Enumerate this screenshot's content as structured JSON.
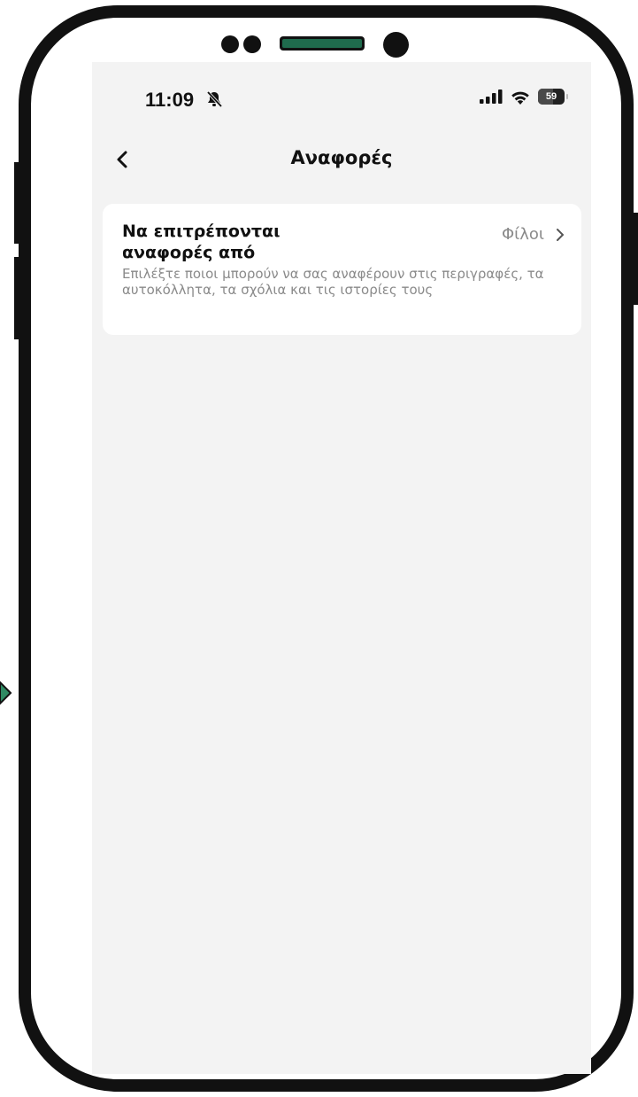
{
  "status_bar": {
    "time": "11:09",
    "battery": "59",
    "icons": [
      "bell-slash-icon",
      "signal-icon",
      "wifi-icon",
      "battery-icon"
    ]
  },
  "header": {
    "title": "Αναφορές",
    "back_icon": "chevron-left-icon"
  },
  "settings": {
    "item": {
      "title": "Να επιτρέπονται αναφορές από",
      "description": "Επιλέξτε ποιοι μπορούν να σας αναφέρουν στις περιγραφές, τα αυτοκόλλητα, τα σχόλια και τις ιστορίες τους",
      "value": "Φίλοι",
      "chevron_icon": "chevron-right-icon"
    }
  },
  "colors": {
    "screen_background": "#f3f3f3",
    "card_background": "#ffffff",
    "secondary_text": "#8a8a8a",
    "frame": "#111111",
    "accent_green": "#1f6b4d"
  }
}
